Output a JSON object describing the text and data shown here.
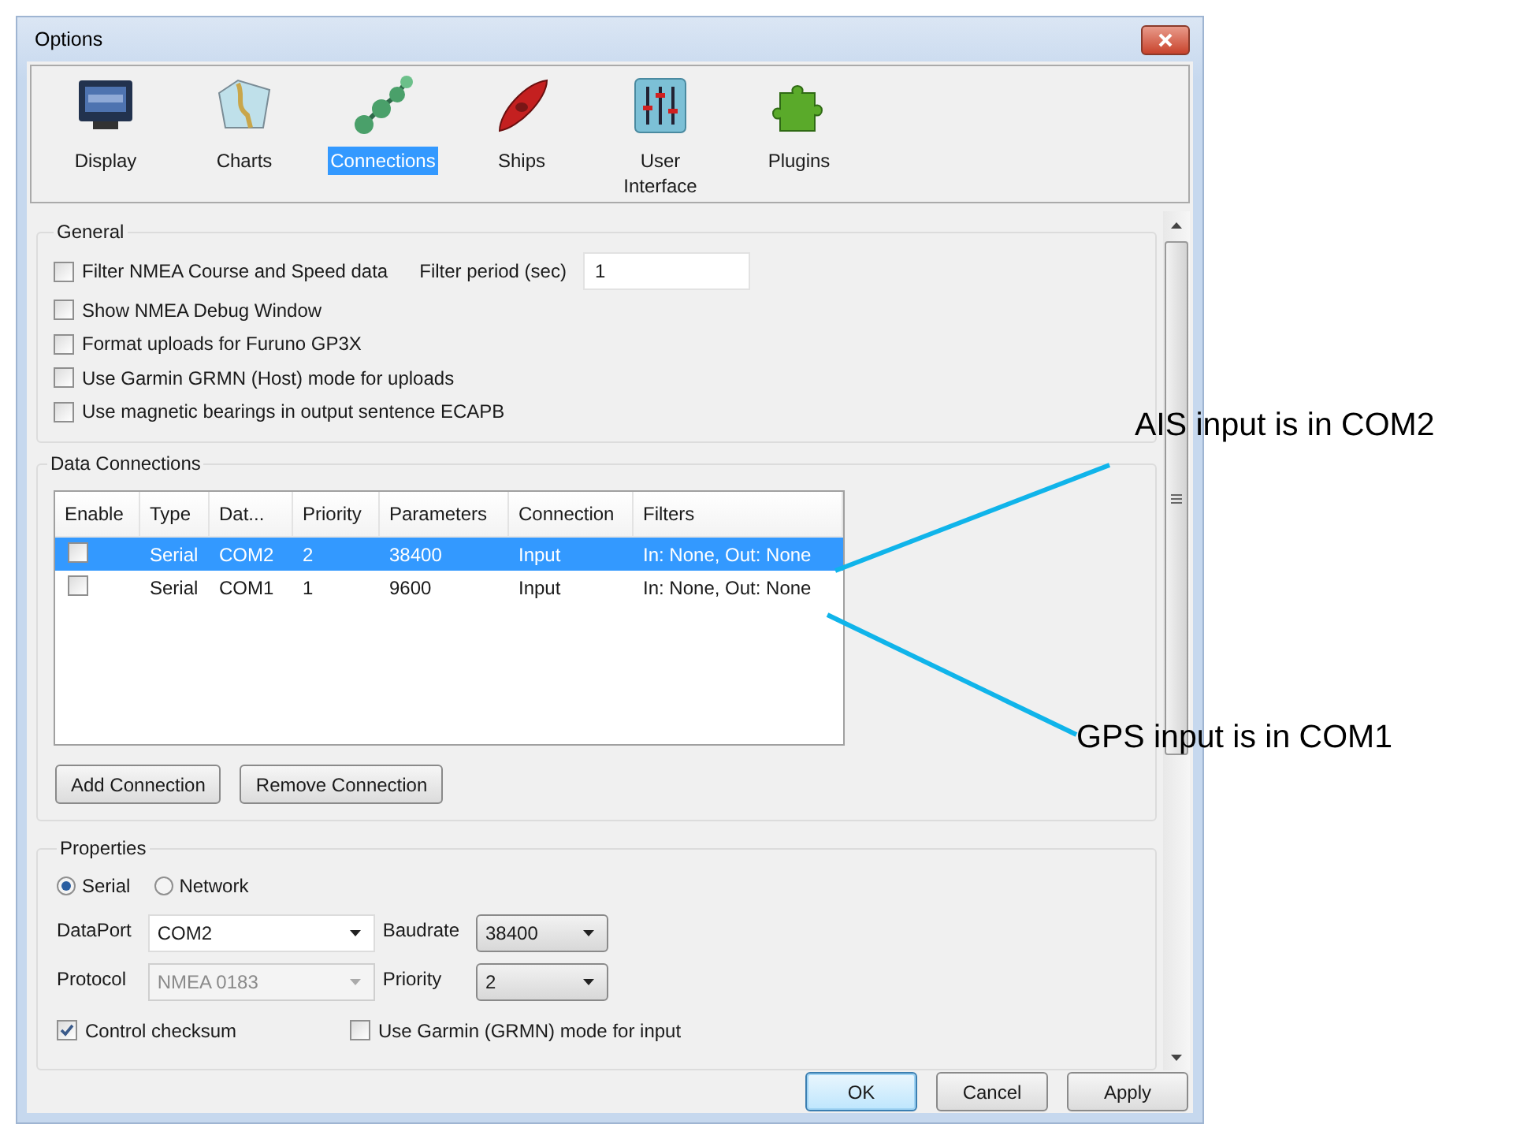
{
  "window": {
    "title": "Options"
  },
  "categories": [
    {
      "label": "Display",
      "selected": false
    },
    {
      "label": "Charts",
      "selected": false
    },
    {
      "label": "Connections",
      "selected": true
    },
    {
      "label": "Ships",
      "selected": false
    },
    {
      "label": "User Interface",
      "selected": false
    },
    {
      "label": "Plugins",
      "selected": false
    }
  ],
  "general": {
    "title": "General",
    "filter": {
      "label": "Filter NMEA Course and Speed data",
      "checked": false
    },
    "filter_period": {
      "label": "Filter period (sec)",
      "value": "1"
    },
    "options": [
      {
        "label": "Show NMEA Debug Window",
        "checked": false
      },
      {
        "label": "Format uploads for Furuno GP3X",
        "checked": false
      },
      {
        "label": "Use Garmin GRMN (Host) mode for uploads",
        "checked": false
      },
      {
        "label": "Use magnetic bearings in output sentence ECAPB",
        "checked": false
      }
    ]
  },
  "data_connections": {
    "title": "Data Connections",
    "columns": [
      "Enable",
      "Type",
      "Dat...",
      "Priority",
      "Parameters",
      "Connection",
      "Filters"
    ],
    "rows": [
      {
        "enabled": false,
        "selected": true,
        "cells": [
          "",
          "Serial",
          "COM2",
          "2",
          "38400",
          "Input",
          "In: None, Out: None"
        ]
      },
      {
        "enabled": false,
        "selected": false,
        "cells": [
          "",
          "Serial",
          "COM1",
          "1",
          "9600",
          "Input",
          "In: None, Out: None"
        ]
      }
    ],
    "buttons": [
      "Add Connection",
      "Remove Connection"
    ]
  },
  "properties": {
    "title": "Properties",
    "connection_types": [
      {
        "label": "Serial",
        "selected": true
      },
      {
        "label": "Network",
        "selected": false
      }
    ],
    "fields": [
      {
        "label": "DataPort",
        "value": "COM2",
        "disabled": false
      },
      {
        "label": "Baudrate",
        "value": "38400",
        "disabled": false
      },
      {
        "label": "Protocol",
        "value": "NMEA 0183",
        "disabled": true
      },
      {
        "label": "Priority",
        "value": "2",
        "disabled": false
      }
    ],
    "checks": [
      {
        "label": "Control checksum",
        "checked": true
      },
      {
        "label": "Use Garmin (GRMN) mode for input",
        "checked": false
      }
    ]
  },
  "buttons": [
    {
      "label": "OK",
      "default": true
    },
    {
      "label": "Cancel",
      "default": false
    },
    {
      "label": "Apply",
      "default": false
    }
  ],
  "annotations": [
    {
      "text": "AIS input is in COM2"
    },
    {
      "text": "GPS input is in COM1"
    }
  ]
}
